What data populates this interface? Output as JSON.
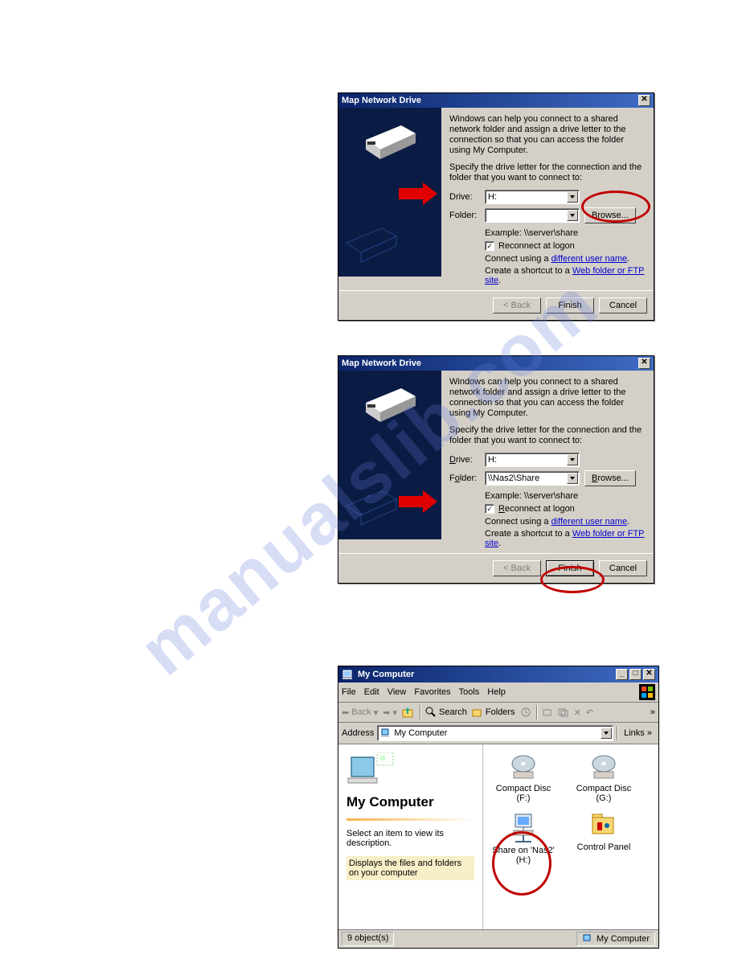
{
  "watermark": "manualslib.com",
  "dialog1": {
    "title": "Map Network Drive",
    "desc1": "Windows can help you connect to a shared network folder and assign a drive letter to the connection so that you can access the folder using My Computer.",
    "desc2": "Specify the drive letter for the connection and the folder that you want to connect to:",
    "drive_label": "Drive:",
    "drive_value": "H:",
    "folder_label": "Folder:",
    "folder_value": "",
    "browse_btn": "Browse...",
    "example": "Example: \\\\server\\share",
    "reconnect": "Reconnect at logon",
    "connect_using": "Connect using a ",
    "diff_user": "different user name",
    "create_shortcut": "Create a shortcut to a ",
    "webfolder": "Web folder or FTP site",
    "period": ".",
    "back": "< Back",
    "finish": "Finish",
    "cancel": "Cancel"
  },
  "dialog2": {
    "title": "Map Network Drive",
    "desc1": "Windows can help you connect to a shared network folder and assign a drive letter to the connection so that you can access the folder using My Computer.",
    "desc2": "Specify the drive letter for the connection and the folder that you want to connect to:",
    "drive_label": "Drive:",
    "drive_value": "H:",
    "folder_label": "Folder:",
    "folder_value": "\\\\Nas2\\Share",
    "browse_btn": "Browse...",
    "example": "Example: \\\\server\\share",
    "reconnect": "Reconnect at logon",
    "connect_using": "Connect using a ",
    "diff_user": "different user name",
    "create_shortcut": "Create a shortcut to a ",
    "webfolder": "Web folder or FTP site",
    "period": ".",
    "back": "< Back",
    "finish": "Finish",
    "cancel": "Cancel"
  },
  "explorer": {
    "title": "My Computer",
    "menu": {
      "file": "File",
      "edit": "Edit",
      "view": "View",
      "fav": "Favorites",
      "tools": "Tools",
      "help": "Help"
    },
    "toolbar": {
      "back": "Back",
      "search": "Search",
      "folders": "Folders"
    },
    "address_label": "Address",
    "address_value": "My Computer",
    "links": "Links",
    "panel_title": "My Computer",
    "panel_line1": "Select an item to view its description.",
    "panel_line2": "Displays the files and folders on your computer",
    "items": {
      "cdf": "Compact Disc (F:)",
      "cdg": "Compact Disc (G:)",
      "share": "Share on 'Nas2' (H:)",
      "cp": "Control Panel"
    },
    "status_left": "9 object(s)",
    "status_right": "My Computer"
  }
}
